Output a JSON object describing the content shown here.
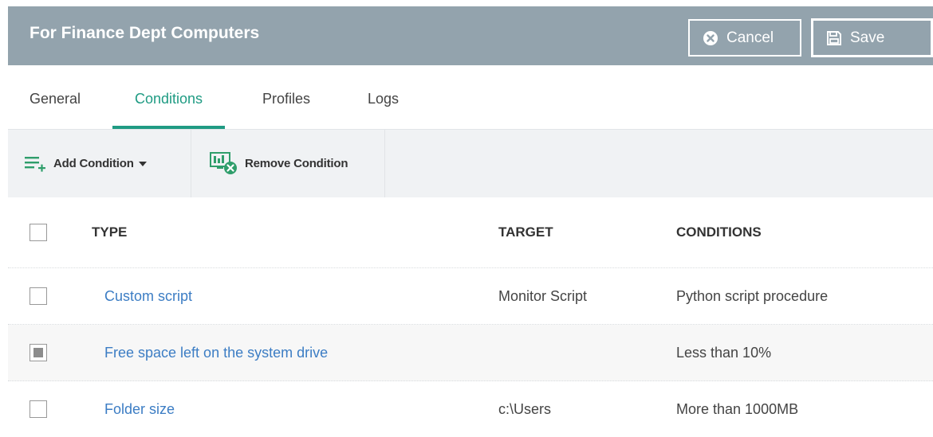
{
  "header": {
    "title": "For Finance Dept Computers",
    "cancel_label": "Cancel",
    "save_label": "Save",
    "background": "#93a3ad"
  },
  "tabs": [
    {
      "label": "General",
      "active": false
    },
    {
      "label": "Conditions",
      "active": true
    },
    {
      "label": "Profiles",
      "active": false
    },
    {
      "label": "Logs",
      "active": false
    }
  ],
  "toolbar": {
    "add_condition_label": "Add Condition",
    "remove_condition_label": "Remove Condition"
  },
  "table": {
    "columns": [
      "TYPE",
      "TARGET",
      "CONDITIONS"
    ],
    "rows": [
      {
        "type": "Custom script",
        "target": "Monitor Script",
        "conditions": "Python script procedure",
        "checked": false
      },
      {
        "type": "Free space left on the system drive",
        "target": "",
        "conditions": "Less than 10%",
        "checked": true
      },
      {
        "type": "Folder size",
        "target": "c:\\Users",
        "conditions": "More than 1000MB",
        "checked": false
      }
    ]
  },
  "colors": {
    "accent": "#1f9b83",
    "link": "#3c7dc4",
    "icon_green": "#2f9e6b"
  }
}
